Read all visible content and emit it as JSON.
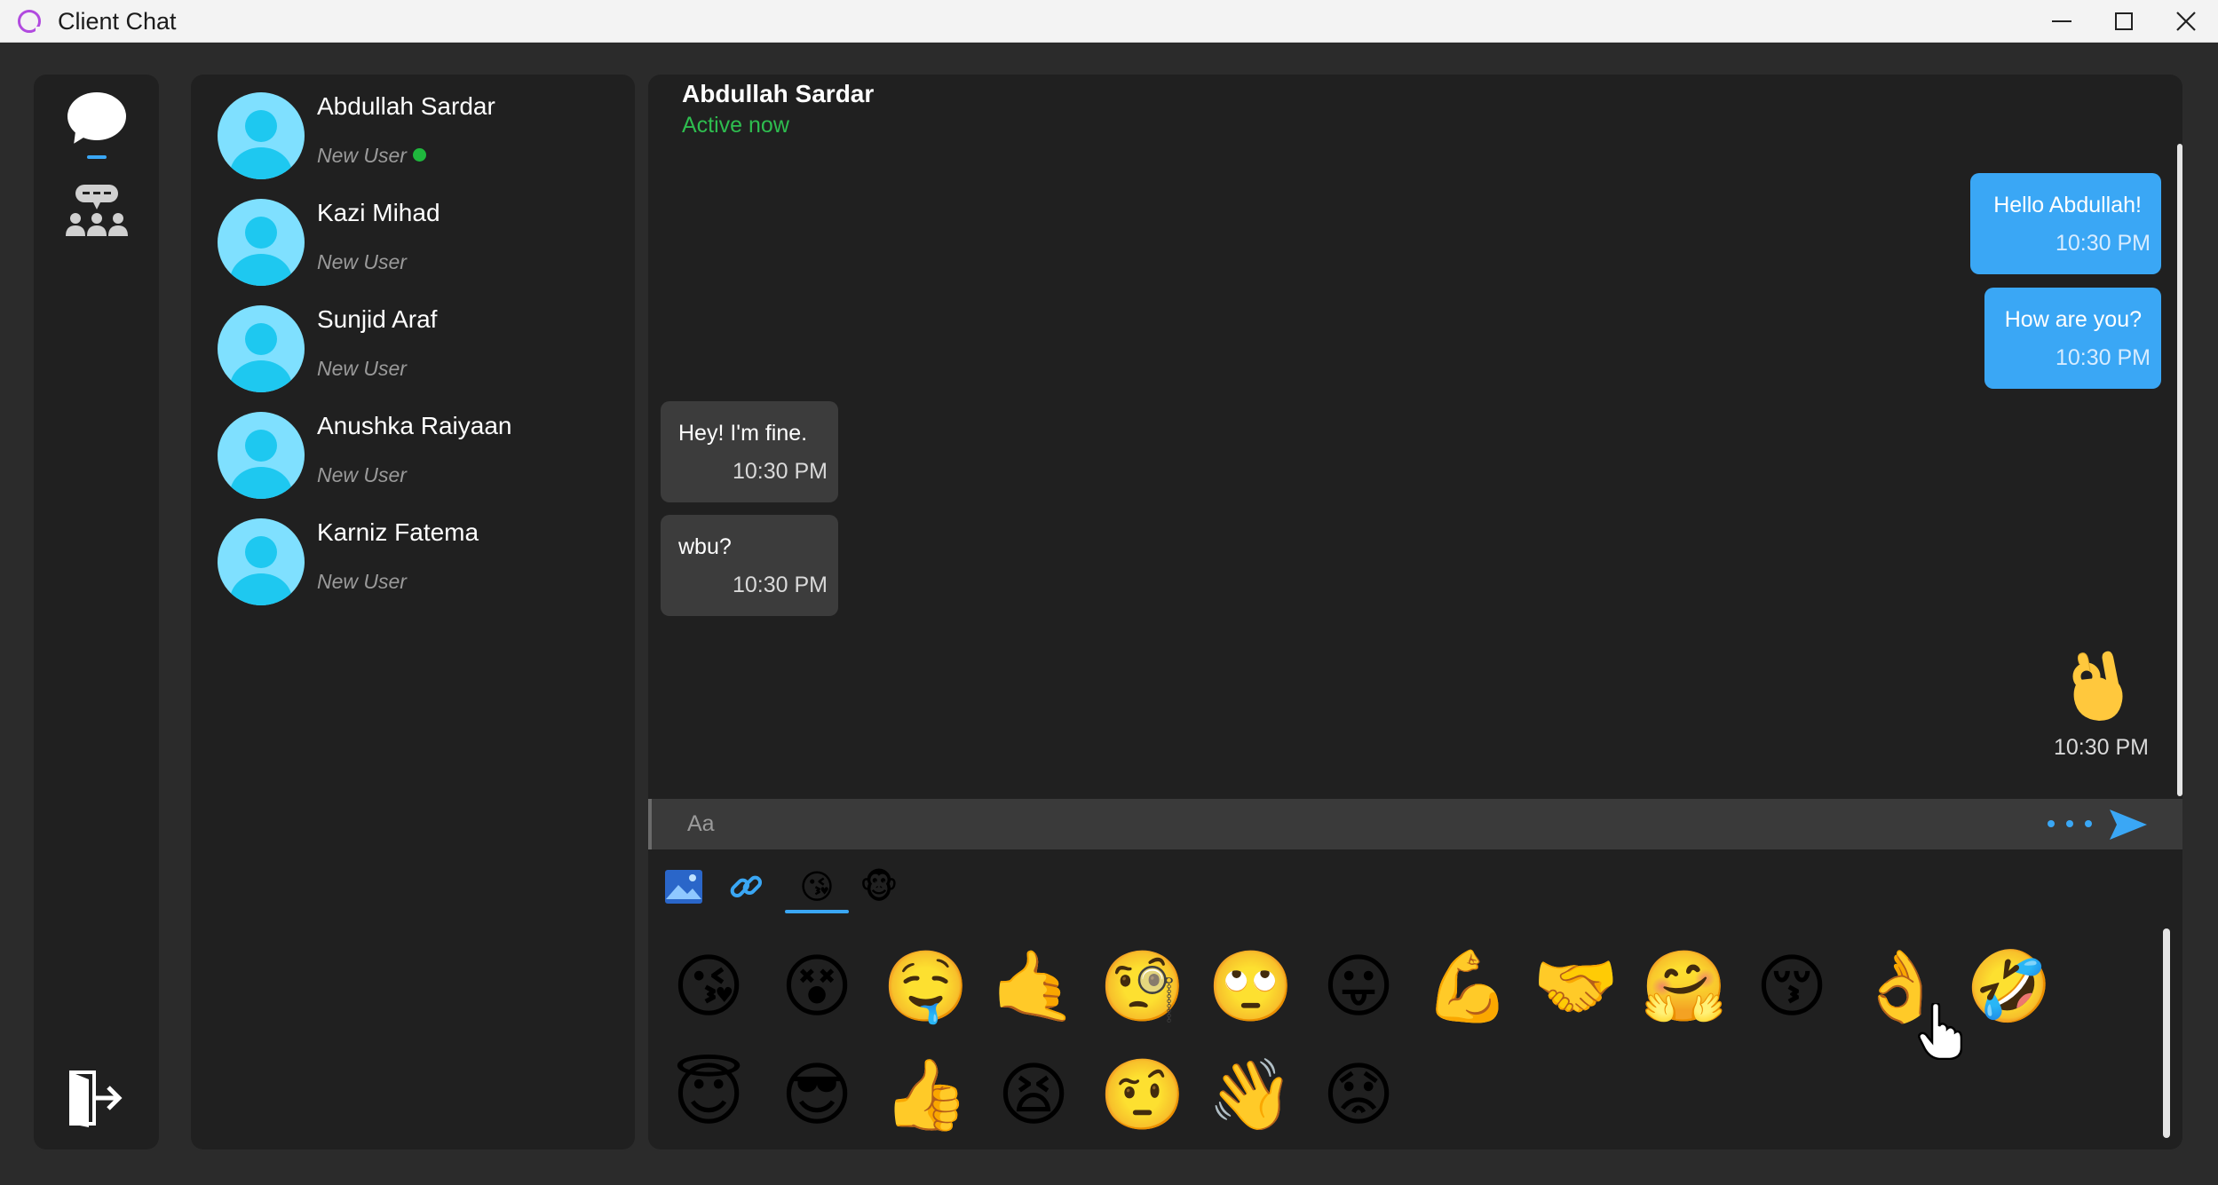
{
  "window": {
    "title": "Client Chat",
    "minimize_icon": "minimize-icon",
    "maximize_icon": "maximize-icon",
    "close_icon": "close-icon"
  },
  "rail": {
    "items": [
      {
        "icon": "chat-bubble-icon",
        "active": true
      },
      {
        "icon": "group-chat-icon",
        "active": false
      }
    ],
    "logout_icon": "logout-icon"
  },
  "contacts": [
    {
      "name": "Abdullah Sardar",
      "status": "New User",
      "online": true
    },
    {
      "name": "Kazi Mihad",
      "status": "New User",
      "online": false
    },
    {
      "name": "Sunjid Araf",
      "status": "New User",
      "online": false
    },
    {
      "name": "Anushka Raiyaan",
      "status": "New User",
      "online": false
    },
    {
      "name": "Karniz Fatema",
      "status": "New User",
      "online": false
    }
  ],
  "chat": {
    "header": {
      "name": "Abdullah Sardar",
      "status": "Active now"
    },
    "messages": [
      {
        "direction": "out",
        "text": "Hello Abdullah!",
        "time": "10:30 PM"
      },
      {
        "direction": "out",
        "text": "How are you?",
        "time": "10:30 PM"
      },
      {
        "direction": "in",
        "text": "Hey! I'm fine.",
        "time": "10:30 PM"
      },
      {
        "direction": "in",
        "text": "wbu?",
        "time": "10:30 PM"
      },
      {
        "direction": "out",
        "emoji": "👌",
        "time": "10:30 PM"
      }
    ],
    "input": {
      "placeholder": "Aa",
      "value": ""
    },
    "more_icon": "more-dots-icon",
    "send_icon": "send-icon"
  },
  "emoji_panel": {
    "tabs": [
      {
        "icon": "image-icon",
        "active": false
      },
      {
        "icon": "link-icon",
        "active": false
      },
      {
        "glyph": "😘",
        "active": true
      },
      {
        "glyph": "🐵",
        "active": false
      }
    ],
    "emojis": [
      "😘",
      "😵",
      "🤤",
      "🤙",
      "🧐",
      "🙄",
      "😛",
      "💪",
      "🤝",
      "🤗",
      "😚",
      "👌",
      "🤣",
      "😇",
      "😎",
      "👍",
      "😫",
      "🤨",
      "👋",
      "😟"
    ]
  },
  "colors": {
    "accent": "#3aa7f5",
    "online": "#1fb83d",
    "panel": "#202020",
    "background": "#2b2b2b",
    "incoming_bubble": "#3c3c3c"
  }
}
